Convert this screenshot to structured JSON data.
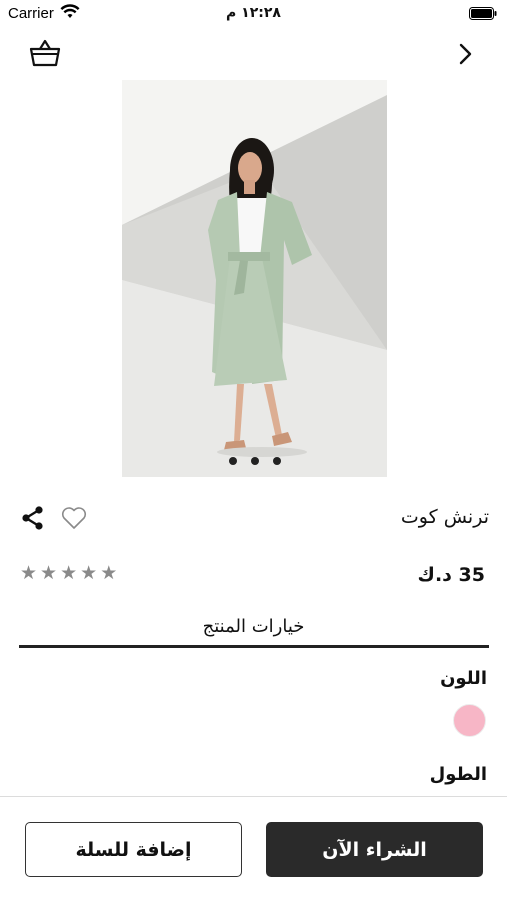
{
  "status_bar": {
    "carrier": "Carrier",
    "time": "١٢:٢٨ م"
  },
  "nav": {
    "basket_icon": "basket-icon",
    "back_icon": "chevron-right-icon"
  },
  "gallery": {
    "image_count": 3,
    "active_index": 2
  },
  "product": {
    "title": "ترنش كوت",
    "price": "35 د.ك",
    "rating_stars": 5,
    "rating_filled": 0
  },
  "tabs": {
    "options_label": "خيارات المنتج"
  },
  "options": {
    "color_label": "اللون",
    "selected_color": "#f7b6c6",
    "length_label": "الطول"
  },
  "actions": {
    "buy_now_label": "الشراء الآن",
    "add_to_cart_label": "إضافة للسلة"
  },
  "colors": {
    "primary_dark": "#2a2a2a",
    "star_color": "#8a8a8a"
  }
}
